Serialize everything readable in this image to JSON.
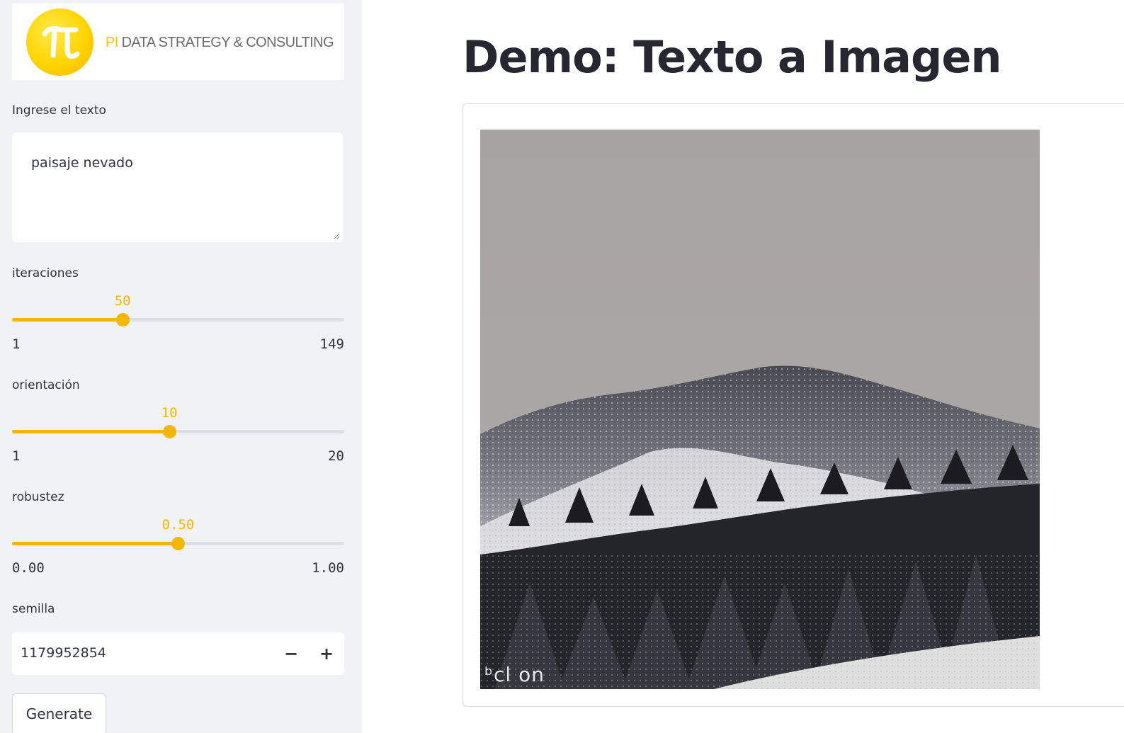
{
  "sidebar": {
    "logo": {
      "brand_prefix": "PI",
      "brand_name": " DATA STRATEGY & CONSULTING",
      "brand_color": "#f5c400"
    },
    "text_input": {
      "label": "Ingrese el texto",
      "value": "paisaje nevado"
    },
    "sliders": [
      {
        "label": "iteraciones",
        "value": "50",
        "min": "1",
        "max": "149",
        "fraction": 0.3333
      },
      {
        "label": "orientación",
        "value": "10",
        "min": "1",
        "max": "20",
        "fraction": 0.4737
      },
      {
        "label": "robustez",
        "value": "0.50",
        "min": "0.00",
        "max": "1.00",
        "fraction": 0.5
      }
    ],
    "seed": {
      "label": "semilla",
      "value": "1179952854",
      "minus": "−",
      "plus": "+"
    },
    "generate_label": "Generate"
  },
  "main": {
    "title": "Demo: Texto a Imagen",
    "image": {
      "watermark": "ᵇcl on",
      "alt_subject": "snowy mountain landscape with pine forest"
    }
  },
  "colors": {
    "accent": "#f2b705",
    "sidebar_bg": "#f0f2f6",
    "track": "#dcdfe6"
  }
}
